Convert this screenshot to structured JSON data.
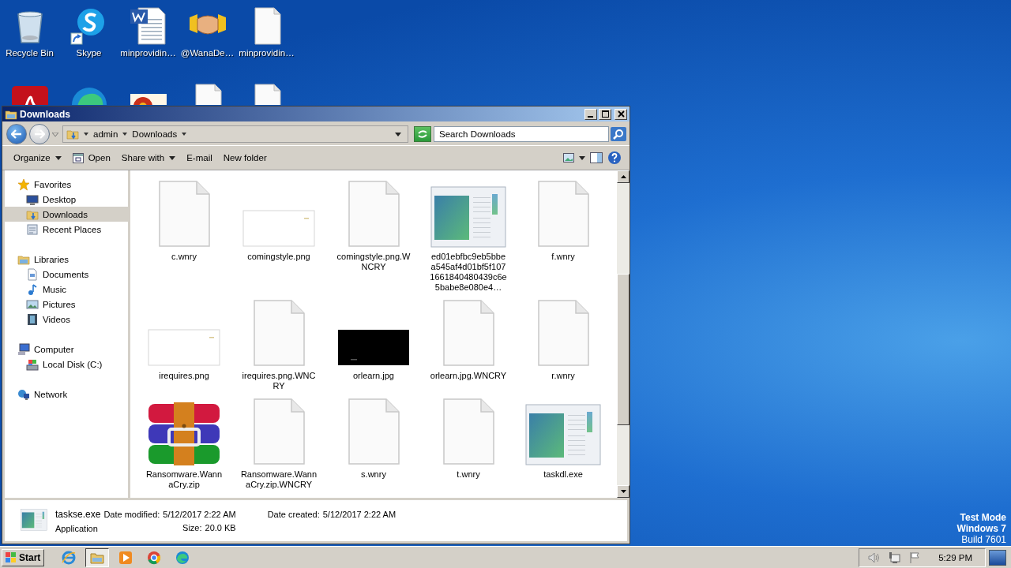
{
  "desktop": {
    "icons": [
      {
        "kind": "recycle-bin",
        "label": "Recycle Bin"
      },
      {
        "kind": "skype",
        "label": "Skype"
      },
      {
        "kind": "word-doc",
        "label": "minprovidin…"
      },
      {
        "kind": "handshake",
        "label": "@WanaDe…"
      },
      {
        "kind": "blank",
        "label": "minprovidin…"
      },
      {
        "kind": "pdf"
      },
      {
        "kind": "edge"
      },
      {
        "kind": "photo"
      },
      {
        "kind": "blank"
      },
      {
        "kind": "blank"
      }
    ],
    "watermark_lines": [
      {
        "text": "Test Mode",
        "bold": true
      },
      {
        "text": "Windows 7",
        "bold": true
      },
      {
        "text": "Build 7601",
        "bold": false
      }
    ]
  },
  "window": {
    "title": "Downloads",
    "address": {
      "crumbs": [
        "admin",
        "Downloads"
      ]
    },
    "search": {
      "placeholder": "Search Downloads"
    },
    "toolbar": [
      {
        "label": "Organize",
        "kind": "menu"
      },
      {
        "label": "Open",
        "kind": "icon"
      },
      {
        "label": "Share with",
        "kind": "menu"
      },
      {
        "label": "E-mail",
        "kind": "plain"
      },
      {
        "label": "New folder",
        "kind": "plain"
      }
    ],
    "nav": [
      {
        "label": "Favorites",
        "kind": "star",
        "selected": false,
        "children": [
          {
            "label": "Desktop",
            "kind": "desktop",
            "selected": false
          },
          {
            "label": "Downloads",
            "kind": "downloads",
            "selected": true
          },
          {
            "label": "Recent Places",
            "kind": "recent",
            "selected": false
          }
        ]
      },
      {
        "label": "Libraries",
        "kind": "libraries",
        "selected": false,
        "children": [
          {
            "label": "Documents",
            "kind": "documents",
            "selected": false
          },
          {
            "label": "Music",
            "kind": "music",
            "selected": false
          },
          {
            "label": "Pictures",
            "kind": "pictures",
            "selected": false
          },
          {
            "label": "Videos",
            "kind": "videos",
            "selected": false
          }
        ]
      },
      {
        "label": "Computer",
        "kind": "computer",
        "selected": false,
        "children": [
          {
            "label": "Local Disk (C:)",
            "kind": "disk",
            "selected": false
          }
        ]
      },
      {
        "label": "Network",
        "kind": "network",
        "selected": false
      }
    ],
    "files": [
      {
        "name": "c.wnry",
        "kind": "blank"
      },
      {
        "name": "comingstyle.png",
        "kind": "image-white"
      },
      {
        "name": "comingstyle.png.WNCRY",
        "kind": "blank"
      },
      {
        "name": "ed01ebfbc9eb5bbea545af4d01bf5f1071661840480439c6e5babe8e080e4…",
        "kind": "app"
      },
      {
        "name": "f.wnry",
        "kind": "blank"
      },
      {
        "name": "irequires.png",
        "kind": "image-white"
      },
      {
        "name": "irequires.png.WNCRY",
        "kind": "blank"
      },
      {
        "name": "orlearn.jpg",
        "kind": "image-black"
      },
      {
        "name": "orlearn.jpg.WNCRY",
        "kind": "blank"
      },
      {
        "name": "r.wnry",
        "kind": "blank"
      },
      {
        "name": "Ransomware.WannaCry.zip",
        "kind": "archive"
      },
      {
        "name": "Ransomware.WannaCry.zip.WNCRY",
        "kind": "blank"
      },
      {
        "name": "s.wnry",
        "kind": "blank"
      },
      {
        "name": "t.wnry",
        "kind": "blank"
      },
      {
        "name": "taskdl.exe",
        "kind": "app"
      }
    ],
    "details": {
      "name": "taskse.exe",
      "type": "Application",
      "fields": [
        {
          "label": "Date modified:",
          "value": "5/12/2017 2:22 AM"
        },
        {
          "label": "Date created:",
          "value": "5/12/2017 2:22 AM"
        },
        {
          "label": "Size:",
          "value": "20.0 KB"
        }
      ]
    }
  },
  "taskbar": {
    "start": "Start",
    "apps": [
      {
        "kind": "ie",
        "selected": false
      },
      {
        "kind": "explorer",
        "selected": true
      },
      {
        "kind": "media",
        "selected": false
      },
      {
        "kind": "chrome",
        "selected": false
      },
      {
        "kind": "edge",
        "selected": false
      }
    ],
    "clock": "5:29 PM"
  }
}
